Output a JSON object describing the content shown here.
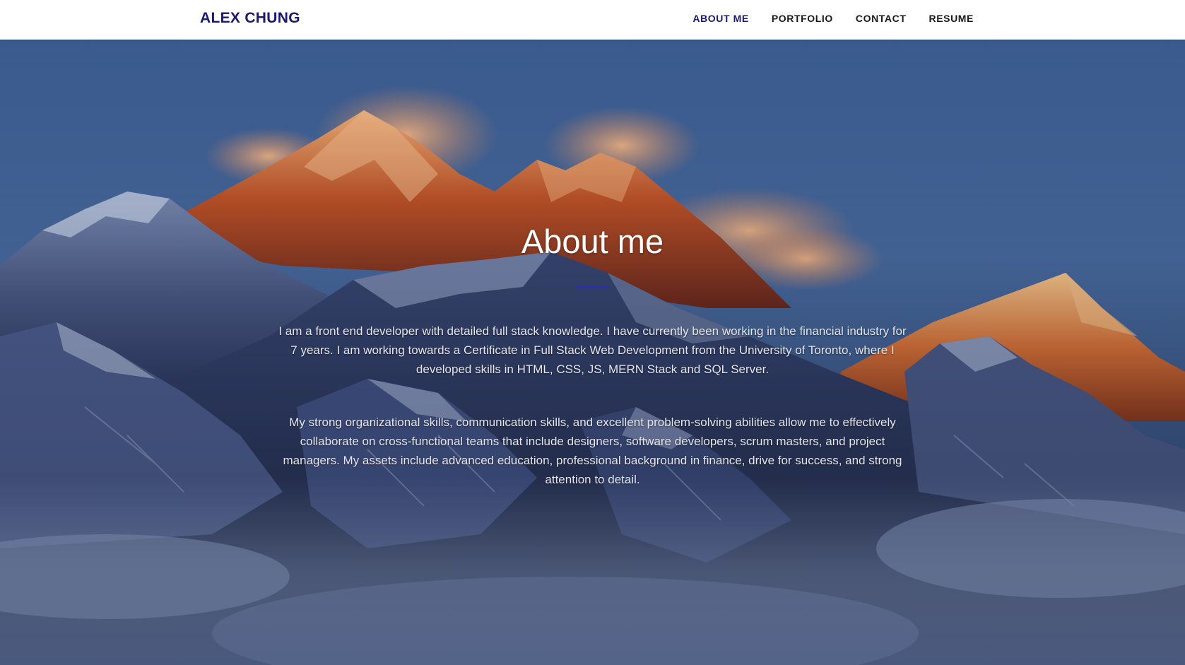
{
  "navbar": {
    "brand": "ALEX CHUNG",
    "links": [
      {
        "label": "ABOUT ME",
        "active": true
      },
      {
        "label": "PORTFOLIO",
        "active": false
      },
      {
        "label": "CONTACT",
        "active": false
      },
      {
        "label": "RESUME",
        "active": false
      }
    ]
  },
  "about": {
    "title": "About me",
    "paragraphs": [
      "I am a front end developer with detailed full stack knowledge. I have currently been working in the financial industry for 7 years. I am working towards a Certificate in Full Stack Web Development from the University of Toronto, where I developed skills in HTML, CSS, JS, MERN Stack and SQL Server.",
      "My strong organizational skills, communication skills, and excellent problem-solving abilities allow me to effectively collaborate on cross-functional teams that include designers, software developers, scrum masters, and project managers. My assets include advanced education, professional background in finance, drive for success, and strong attention to detail."
    ]
  },
  "colors": {
    "brand": "#1a1a6e",
    "nav_active": "#1a1a6e",
    "nav_text": "#1a1a1a",
    "divider": "#2a2acc"
  },
  "icons": {
    "hero_background": "mountain-landscape"
  }
}
